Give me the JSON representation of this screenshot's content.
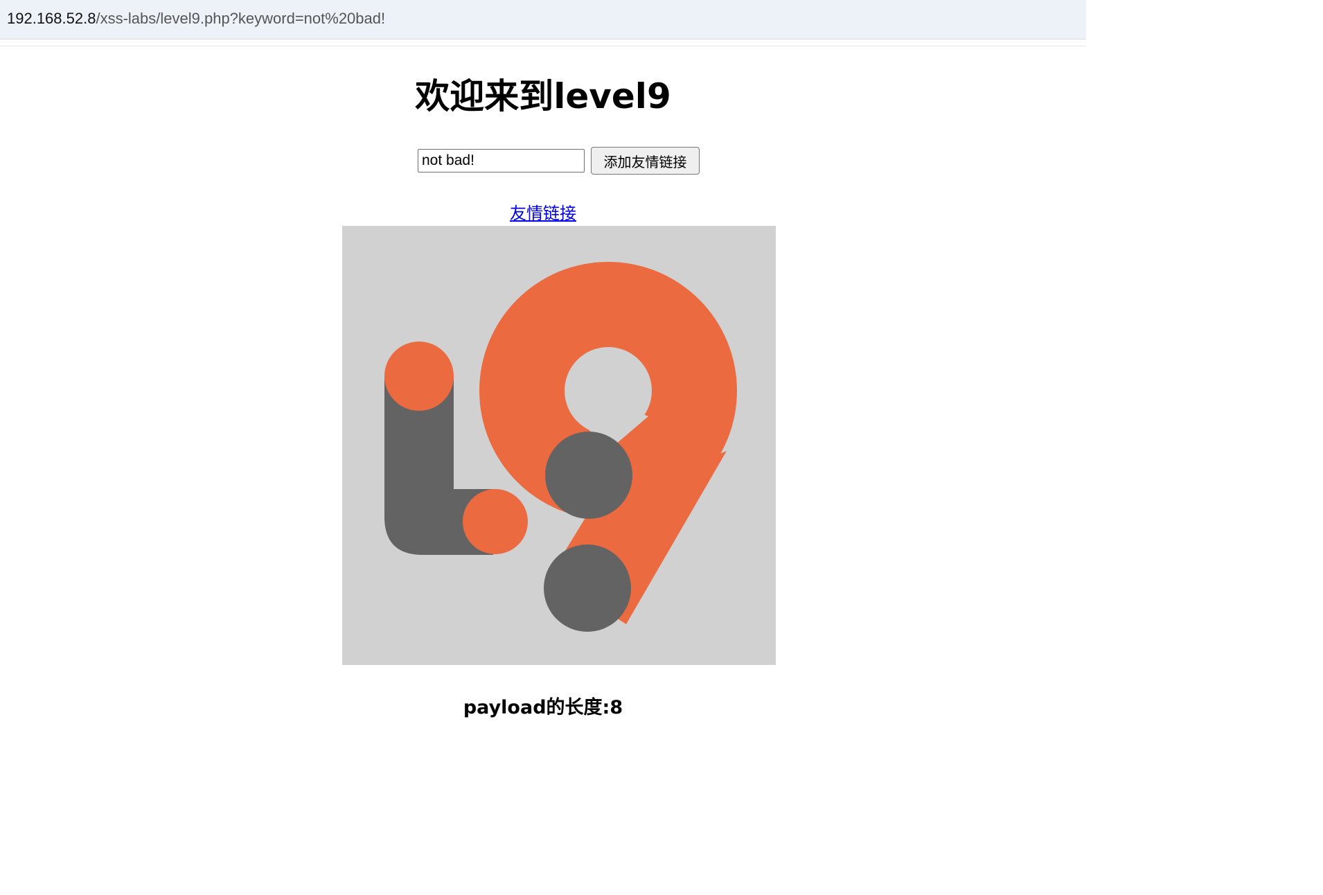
{
  "browser": {
    "url_host": "192.168.52.8",
    "url_path": "/xss-labs/level9.php?keyword=not%20bad!"
  },
  "page": {
    "title": "欢迎来到level9",
    "keyword_value": "not bad!",
    "submit_label": "添加友情链接",
    "link_text": "友情链接",
    "payload_text": "payload的长度:8"
  },
  "colors": {
    "accent_orange": "#eb6a40",
    "dark_gray": "#636363",
    "logo_background": "#d1d1d1",
    "link_blue": "#0000ee"
  }
}
